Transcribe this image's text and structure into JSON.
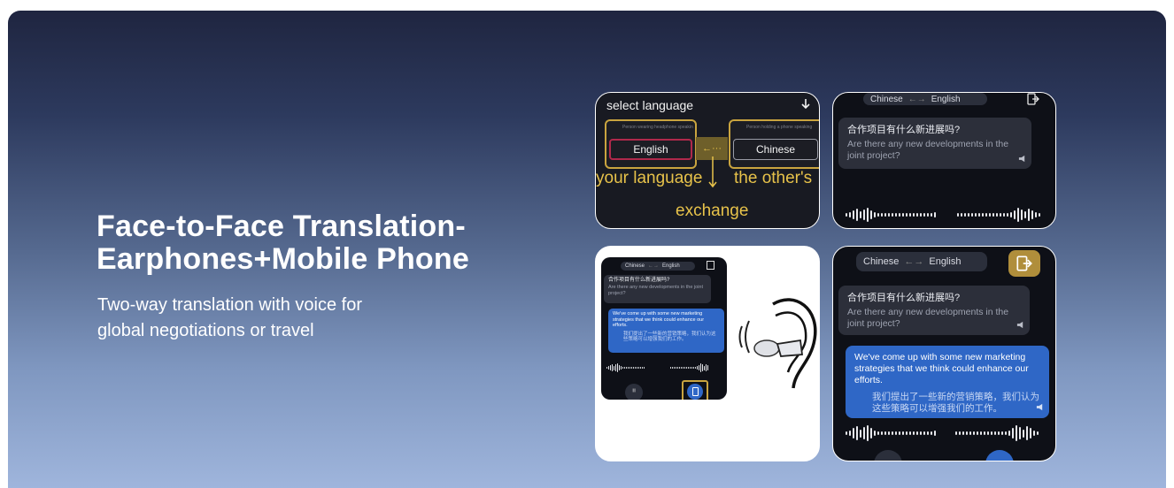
{
  "headline": {
    "line1": "Face-to-Face Translation-",
    "line2": "Earphones+Mobile Phone"
  },
  "subtitle": {
    "line1": "Two-way translation with voice for",
    "line2": "global negotiations or travel"
  },
  "tile1": {
    "title": "select language",
    "left_caption": "Person wearing headphone speaking",
    "right_caption": "Person holding a phone speaking",
    "left_lang": "English",
    "right_lang": "Chinese",
    "arrow": "←···",
    "ann_left": "your language",
    "ann_right": "the other's",
    "ann_bottom": "exchange"
  },
  "conversation": {
    "lang_left": "Chinese",
    "lang_right": "English",
    "swap": "←→",
    "q_zh": "合作项目有什么新进展吗?",
    "q_en": "Are there any new developments in the joint project?",
    "a_en": "We've come up with some new marketing strategies that we think could enhance our efforts.",
    "a_zh": "我们提出了一些新的营销策略，我们认为这些策略可以增强我们的工作。"
  },
  "icons": [
    "download-arrow-icon",
    "swap-arrow-icon",
    "exit-icon",
    "speaker-icon",
    "earbuds-icon",
    "phone-icon",
    "earphone-illustration"
  ],
  "colors": {
    "accent_yellow": "#e7c24a",
    "bubble_blue": "#2f67c6",
    "bubble_dark": "#2c2f3a"
  }
}
